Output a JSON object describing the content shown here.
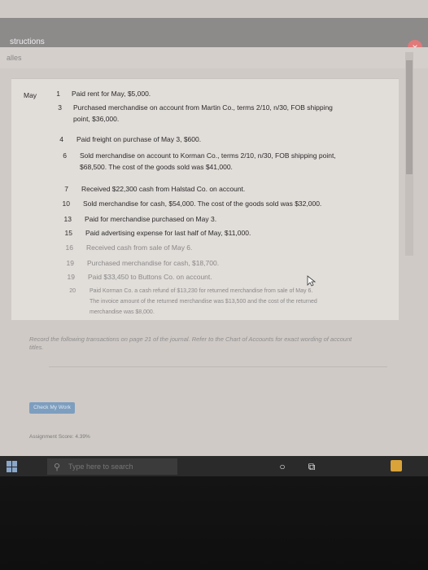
{
  "window": {
    "title": "structions",
    "subtab": "alles",
    "close_icon": "×"
  },
  "journal": {
    "month": "May",
    "entries": [
      {
        "day": "1",
        "lines": [
          "Paid rent for May, $5,000."
        ]
      },
      {
        "day": "3",
        "lines": [
          "Purchased merchandise on account from Martin Co., terms 2/10, n/30, FOB shipping",
          "point, $36,000."
        ]
      },
      {
        "day": "4",
        "lines": [
          "Paid freight on purchase of May 3, $600."
        ]
      },
      {
        "day": "6",
        "lines": [
          "Sold merchandise on account to Korman Co., terms 2/10, n/30, FOB shipping point,",
          "$68,500. The cost of the goods sold was $41,000."
        ]
      },
      {
        "day": "7",
        "lines": [
          "Received $22,300 cash from Halstad Co. on account."
        ]
      },
      {
        "day": "10",
        "lines": [
          "Sold merchandise for cash, $54,000. The cost of the goods sold was $32,000."
        ]
      },
      {
        "day": "13",
        "lines": [
          "Paid for merchandise purchased on May 3."
        ]
      },
      {
        "day": "15",
        "lines": [
          "Paid advertising expense for last half of May, $11,000."
        ]
      },
      {
        "day": "16",
        "lines": [
          "Received cash from sale of May 6."
        ]
      },
      {
        "day": "19",
        "lines": [
          "Purchased merchandise for cash, $18,700."
        ]
      },
      {
        "day": "19",
        "lines": [
          "Paid $33,450 to Buttons Co. on account."
        ]
      },
      {
        "day": "20",
        "lines": [
          "Paid Korman Co. a cash refund of $13,230 for returned merchandise from sale of May 6.",
          "The invoice amount of the returned merchandise was $13,500 and the cost of the returned",
          "merchandise was $8,000."
        ]
      }
    ]
  },
  "instructions": {
    "text1": "Record the following transactions on page 21 of the journal. Refer to the Chart of Accounts for exact wording of account",
    "text2": "titles."
  },
  "actions": {
    "check_label": "Check My Work"
  },
  "status": {
    "text": "Assignment Score: 4.39%"
  },
  "taskbar": {
    "search_placeholder": "Type here to search"
  }
}
